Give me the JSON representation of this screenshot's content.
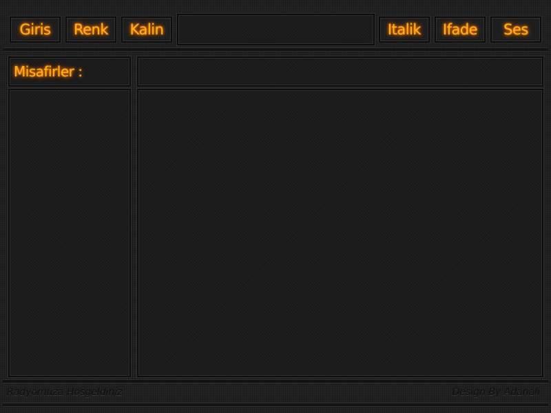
{
  "toolbar": {
    "left_buttons": [
      "Giris",
      "Renk",
      "Kalin"
    ],
    "right_buttons": [
      "Italik",
      "Ifade",
      "Ses"
    ]
  },
  "guests_label": "Misafirler :",
  "footer": {
    "welcome": "Radyomuza Hosgeldiniz",
    "credit": "Design By Adanali"
  },
  "colors": {
    "accent": "#ffb020",
    "glow": "#ff7a00",
    "background": "#202020",
    "panel": "#1c1c1c"
  }
}
